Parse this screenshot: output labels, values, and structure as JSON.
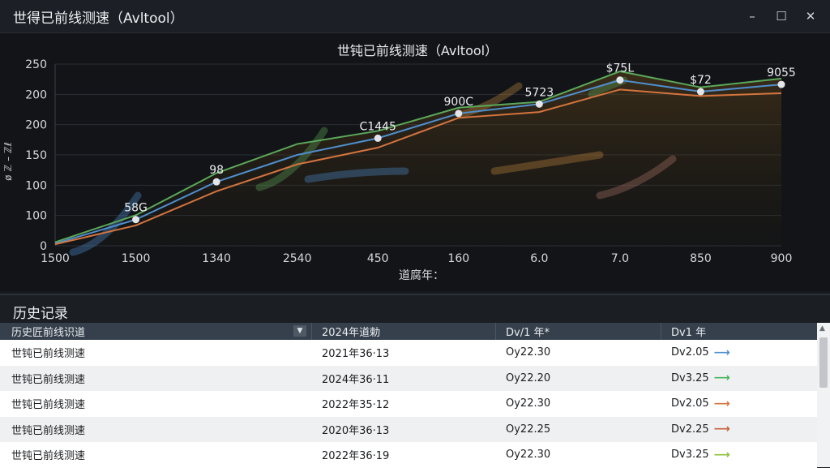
{
  "window": {
    "title": "世得已前线测速（Avltool）",
    "minimize": "–",
    "maximize": "☐",
    "close": "✕"
  },
  "chart_data": {
    "type": "line",
    "title": "世钝已前线测速（Avltool）",
    "xlabel": "道腐年：",
    "ylabel": "ø ℤ – ℤℓ",
    "x_tick_labels": [
      "1500",
      "1500",
      "1340",
      "2540",
      "450",
      "160",
      "6.0",
      "7.0",
      "850",
      "900"
    ],
    "y_tick_labels": [
      "0",
      "100",
      "100",
      "150",
      "200",
      "200",
      "250"
    ],
    "ylim": [
      0,
      250
    ],
    "grid": true,
    "series": [
      {
        "color": "#5ba85a",
        "values": [
          5,
          42,
          100,
          140,
          158,
          190,
          198,
          240,
          218,
          230
        ]
      },
      {
        "color": "#4f8fd0",
        "values": [
          3,
          36,
          88,
          125,
          148,
          182,
          195,
          228,
          212,
          222
        ]
      },
      {
        "color": "#d4743f",
        "values": [
          2,
          28,
          75,
          112,
          135,
          176,
          184,
          215,
          206,
          210
        ]
      }
    ],
    "point_labels": [
      "58G",
      "98",
      "C1445",
      "900C",
      "5723",
      "$75L",
      "$72",
      "9055"
    ],
    "colors": {
      "green": "#5ba85a",
      "blue": "#4f8fd0",
      "orange": "#d4743f",
      "brown": "#b0776a"
    }
  },
  "history": {
    "heading": "历史记录",
    "columns": [
      "历史匠前线识道",
      "2024年道勅",
      "Dv/1 年*",
      "Dv1 年"
    ],
    "rows": [
      {
        "name": "世钝已前线测速",
        "date": "2021年36·13",
        "v1": "Oy22.30",
        "v2": "Dv2.05",
        "trend": "⟶",
        "trend_color": "#4f8fd0"
      },
      {
        "name": "世钝已前线测速",
        "date": "2024年36·11",
        "v1": "Oy22.20",
        "v2": "Dv3.25",
        "trend": "⟶",
        "trend_color": "#4bb35a"
      },
      {
        "name": "世钝已前线测速",
        "date": "2022年35·12",
        "v1": "Oy22.30",
        "v2": "Dv2.05",
        "trend": "⟶",
        "trend_color": "#d4743f"
      },
      {
        "name": "世钝已前线测速",
        "date": "2020年36·13",
        "v1": "Oy22.25",
        "v2": "Dv2.25",
        "trend": "⟶",
        "trend_color": "#c8603c"
      },
      {
        "name": "世钝已前线测速",
        "date": "2022年36·19",
        "v1": "Oy22.30",
        "v2": "Dv3.25",
        "trend": "⟶",
        "trend_color": "#8fbf3a"
      }
    ]
  }
}
